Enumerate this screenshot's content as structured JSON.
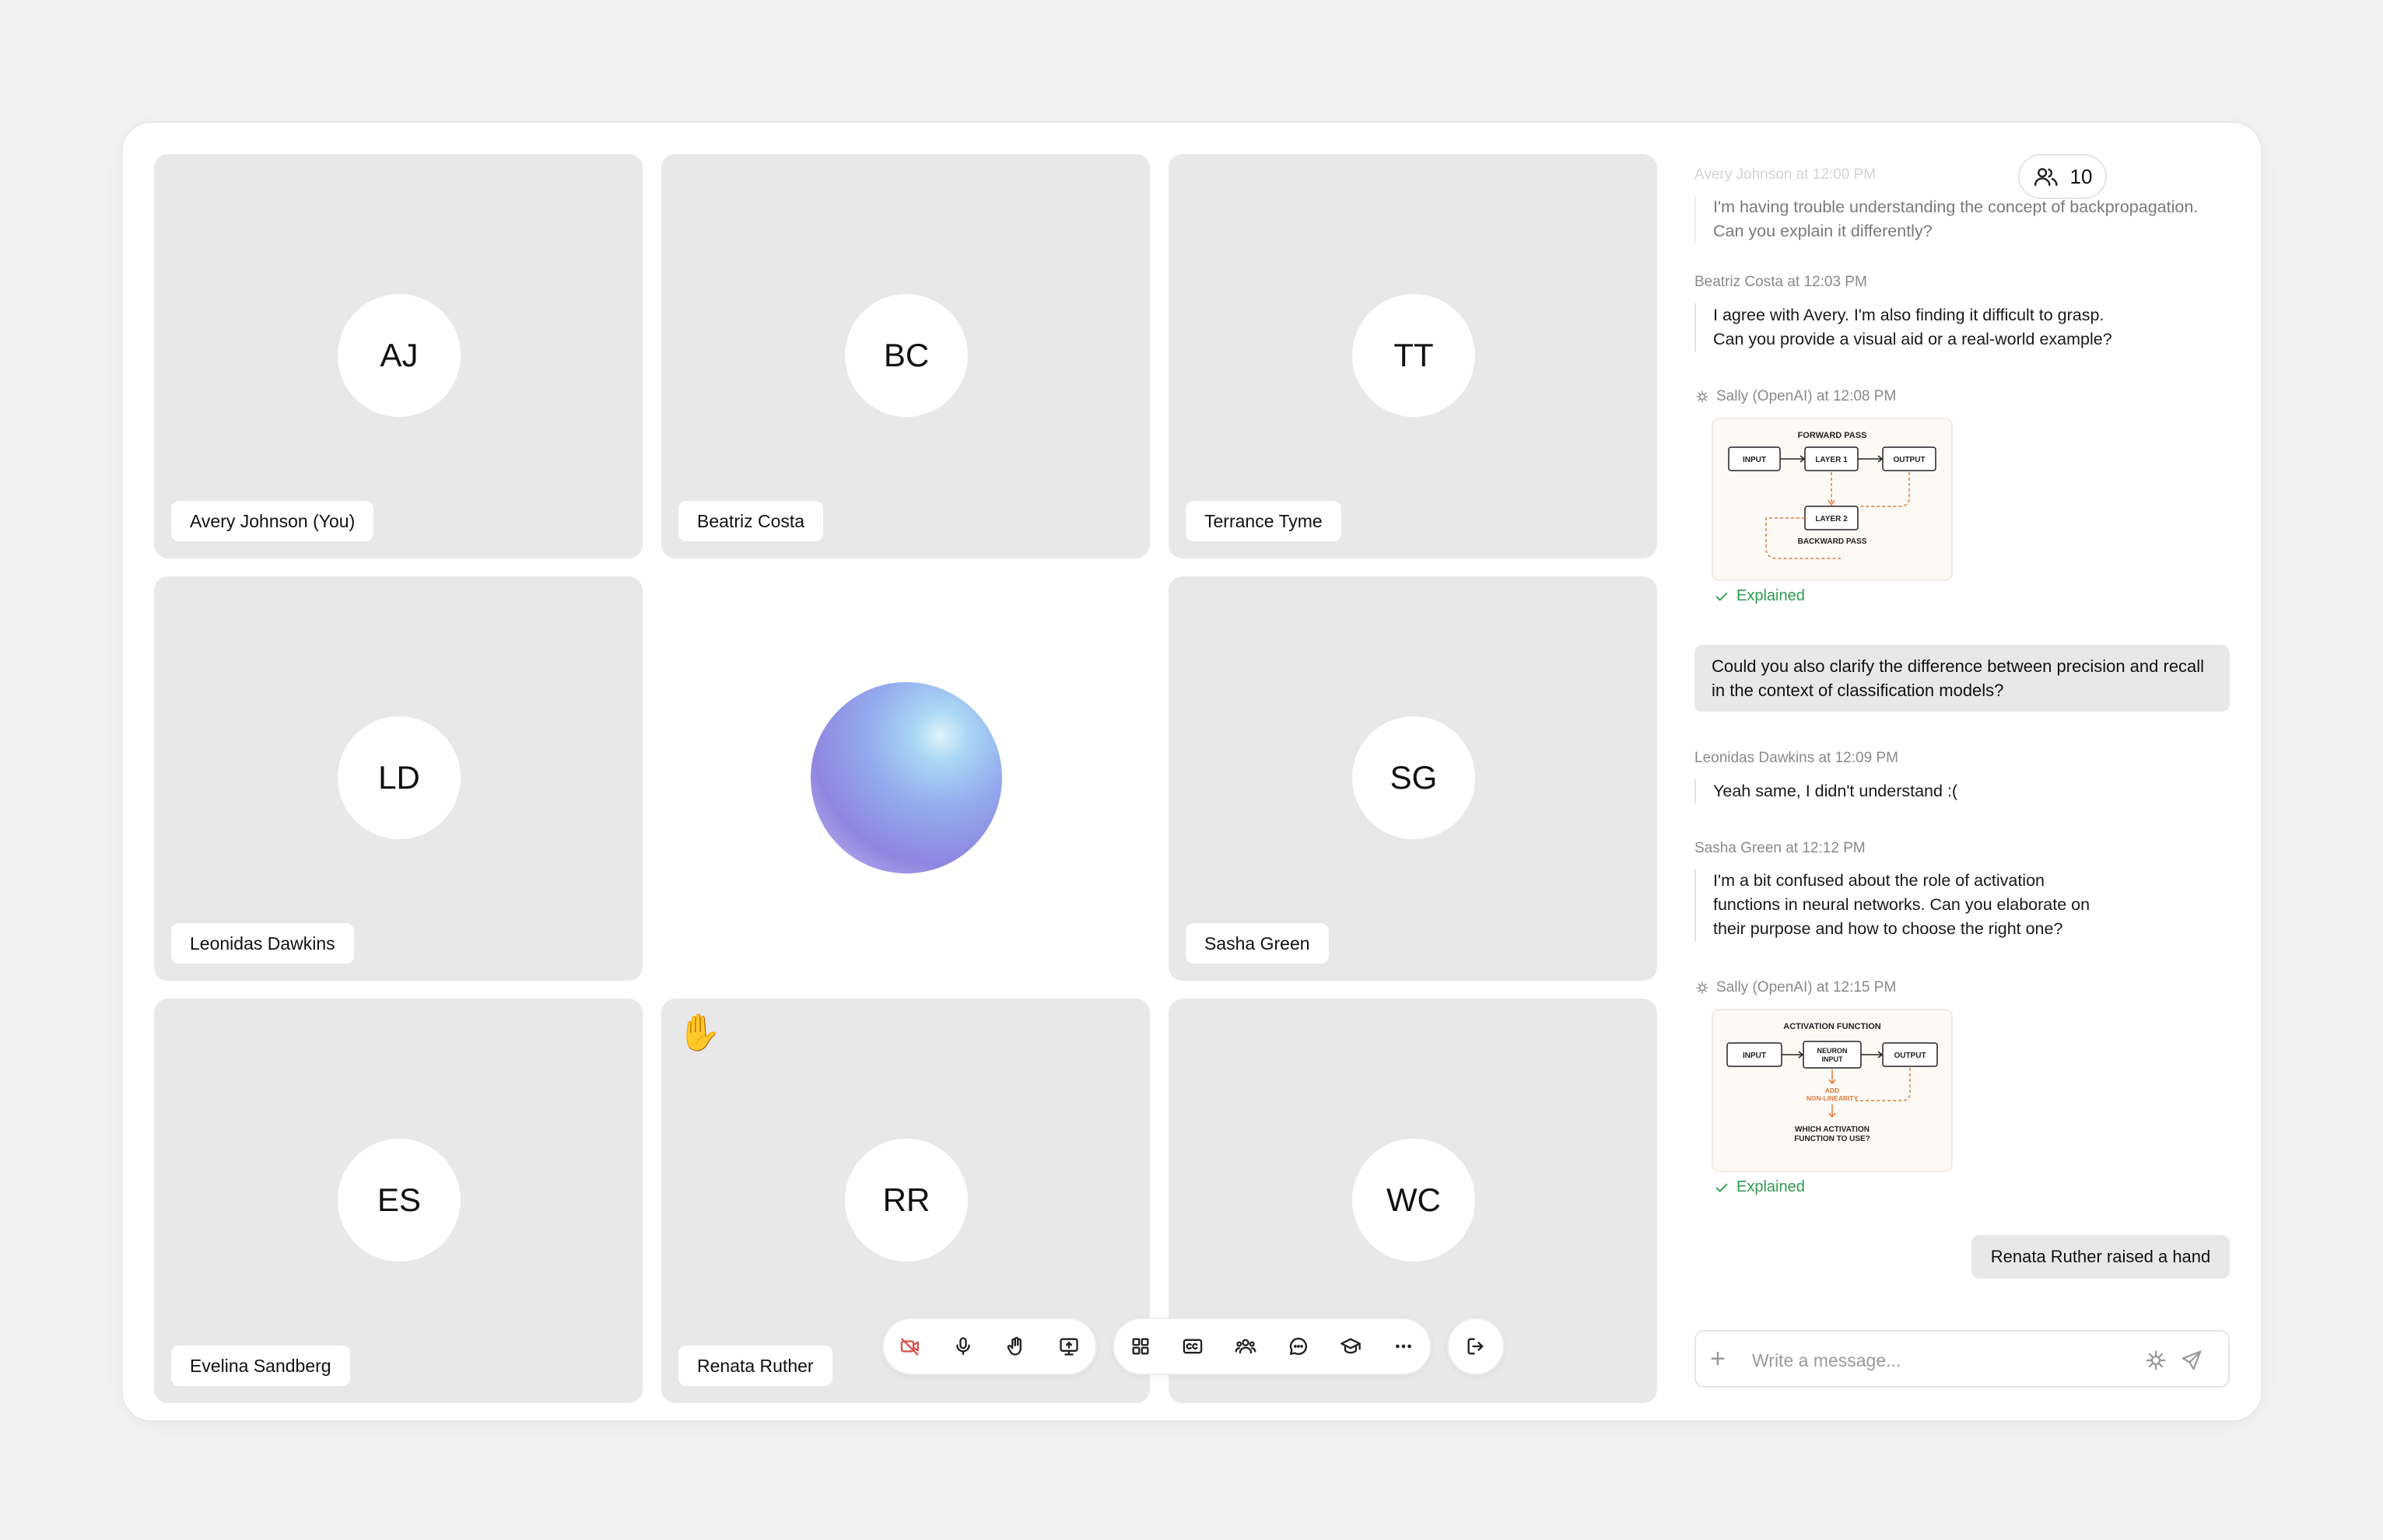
{
  "participants": [
    {
      "initials": "AJ",
      "name": "Avery Johnson (You)"
    },
    {
      "initials": "BC",
      "name": "Beatriz Costa"
    },
    {
      "initials": "TT",
      "name": "Terrance Tyme"
    },
    {
      "initials": "LD",
      "name": "Leonidas Dawkins"
    },
    {
      "initials": "SG",
      "name": "Sasha Green"
    },
    {
      "initials": "ES",
      "name": "Evelina Sandberg"
    },
    {
      "initials": "RR",
      "name": "Renata Ruther"
    },
    {
      "initials": "WC",
      "name": ""
    }
  ],
  "raised_hand_emoji": "✋",
  "people_count": "10",
  "controls": {
    "left": [
      "camera-off-icon",
      "microphone-icon",
      "raise-hand-icon",
      "share-screen-icon"
    ],
    "middle": [
      "grid-view-icon",
      "closed-captions-icon",
      "participants-icon",
      "chat-icon",
      "learn-icon",
      "more-icon"
    ],
    "leave": "leave-icon"
  },
  "chat": {
    "messages": [
      {
        "meta": "Avery Johnson at 12:00 PM",
        "lines": [
          "I'm having trouble understanding the concept of backpropagation.",
          "Can you explain it differently?"
        ]
      },
      {
        "meta": "Beatriz Costa at 12:03 PM",
        "lines": [
          "I agree with Avery. I'm also finding it difficult to grasp.",
          "Can you provide a visual aid or a real-world example?"
        ]
      },
      {
        "meta": "Sally (OpenAI) at 12:08 PM",
        "diagram": {
          "title": "FORWARD PASS",
          "input": "INPUT",
          "layer1": "LAYER 1",
          "output": "OUTPUT",
          "layer2": "LAYER 2",
          "bottom": "BACKWARD PASS"
        },
        "status": "Explained"
      },
      {
        "highlight": "Could you also clarify the difference between precision and recall in the context of classification models?"
      },
      {
        "meta": "Leonidas Dawkins at 12:09 PM",
        "lines": [
          "Yeah same, I didn't understand :("
        ]
      },
      {
        "meta": "Sasha Green at 12:12 PM",
        "lines": [
          "I'm a bit confused about the role of activation",
          "functions in neural networks. Can you elaborate on",
          "their purpose and how to choose the right one?"
        ]
      },
      {
        "meta": "Sally (OpenAI) at 12:15 PM",
        "diagram": {
          "title": "ACTIVATION FUNCTION",
          "input": "INPUT",
          "neuron1": "NEURON",
          "neuron2": "INPUT",
          "output": "OUTPUT",
          "add1": "ADD",
          "add2": "NON-LINEARITY",
          "q1": "WHICH ACTIVATION",
          "q2": "FUNCTION TO USE?"
        },
        "status": "Explained"
      }
    ],
    "system_notice": "Renata Ruther raised a hand",
    "composer_placeholder": "Write a message..."
  },
  "colors": {
    "background": "#f2f2f2",
    "tile": "#e8e8e8",
    "explained_green": "#2e9d4e",
    "camera_off_red": "#d9534f",
    "diagram_orange": "#e07a3c"
  }
}
